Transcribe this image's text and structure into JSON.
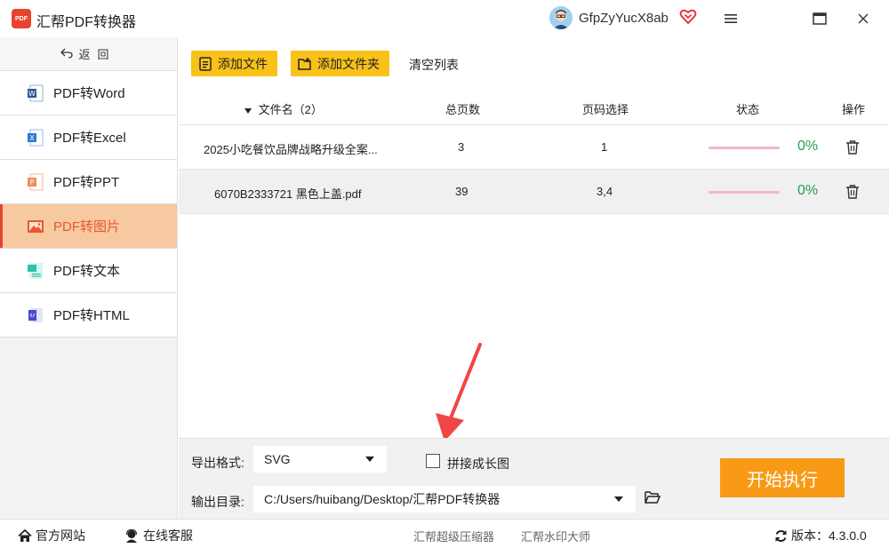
{
  "app": {
    "logo_text": "PDF",
    "title": "汇帮PDF转换器",
    "username": "GfpZyYucX8ab"
  },
  "sidebar": {
    "back_label": "返回",
    "items": [
      {
        "label": "PDF转Word",
        "icon": "word-icon",
        "color": "#2b5797"
      },
      {
        "label": "PDF转Excel",
        "icon": "excel-icon",
        "color": "#2b7bd8"
      },
      {
        "label": "PDF转PPT",
        "icon": "ppt-icon",
        "color": "#f08a5d"
      },
      {
        "label": "PDF转图片",
        "icon": "image-icon",
        "color": "#e8582e",
        "active": true
      },
      {
        "label": "PDF转文本",
        "icon": "text-icon",
        "color": "#2ec4a5"
      },
      {
        "label": "PDF转HTML",
        "icon": "html-icon",
        "color": "#4a4acb"
      }
    ]
  },
  "toolbar": {
    "add_file": "添加文件",
    "add_folder": "添加文件夹",
    "clear_list": "清空列表"
  },
  "table": {
    "headers": {
      "filename": "文件名（2）",
      "pages": "总页数",
      "page_select": "页码选择",
      "status": "状态",
      "actions": "操作"
    },
    "rows": [
      {
        "filename": "2025小吃餐饮品牌战略升级全案...",
        "pages": "3",
        "page_select": "1",
        "progress": "0%",
        "progress_value": 0
      },
      {
        "filename": "6070B2333721 黑色上盖.pdf",
        "pages": "39",
        "page_select": "3,4",
        "progress": "0%",
        "progress_value": 0
      }
    ]
  },
  "options": {
    "format_label": "导出格式:",
    "format_value": "SVG",
    "merge_label": "拼接成长图",
    "output_label": "输出目录:",
    "output_value": "C:/Users/huibang/Desktop/汇帮PDF转换器",
    "start_label": "开始执行"
  },
  "footer": {
    "website": "官方网站",
    "support": "在线客服",
    "link1": "汇帮超级压缩器",
    "link2": "汇帮水印大师",
    "version_label": "版本：",
    "version": "4.3.0.0"
  },
  "colors": {
    "accent": "#f8c21a",
    "start": "#f89a16",
    "active_bg": "#f7c9a1",
    "active_text": "#e8582e",
    "progress_track": "#f2b7c5",
    "pct": "#22a04b"
  }
}
